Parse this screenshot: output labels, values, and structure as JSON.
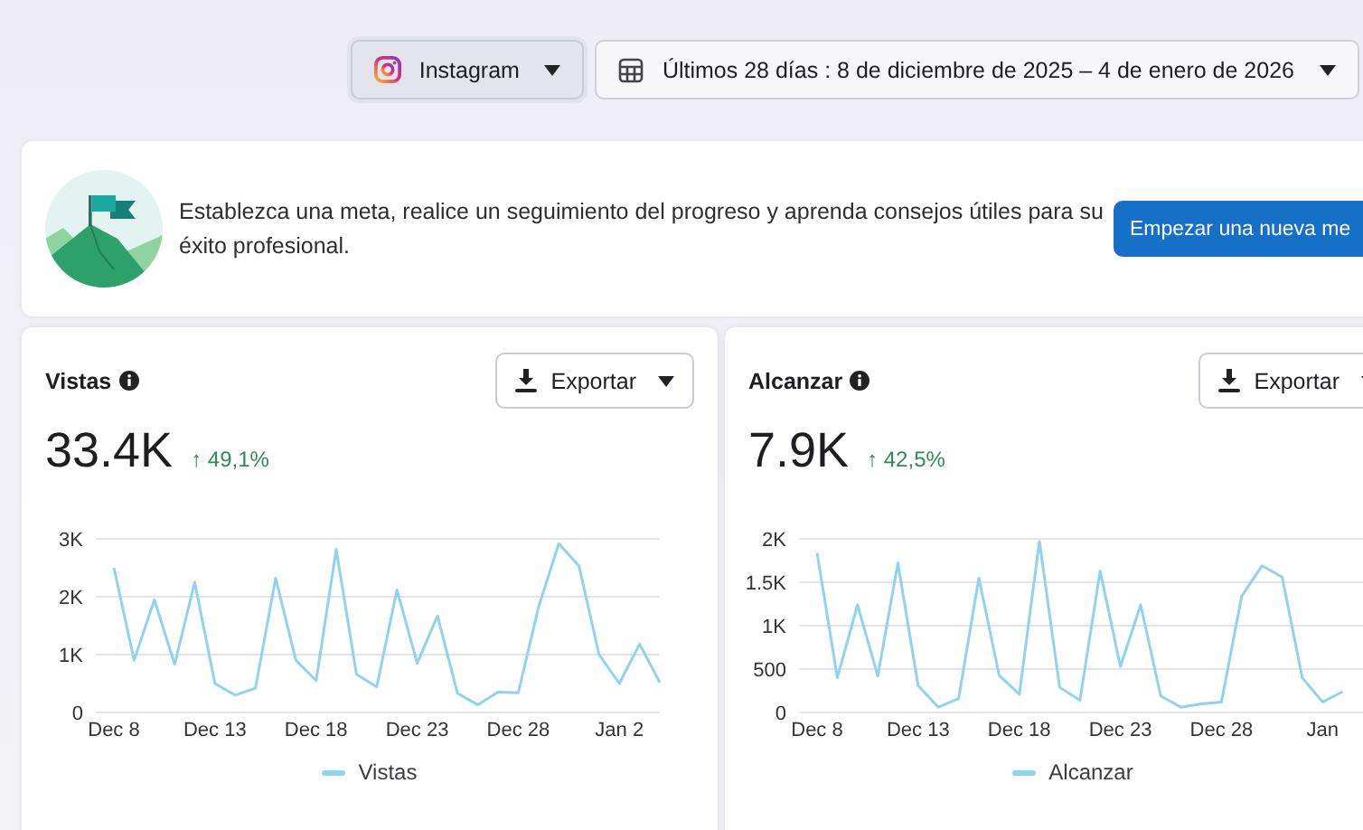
{
  "filters": {
    "platform": {
      "label": "Instagram",
      "selected": true
    },
    "date_range": {
      "label": "Últimos 28 días : 8 de diciembre de 2025 – 4 de enero de 2026"
    }
  },
  "banner": {
    "text": "Establezca una meta, realice un seguimiento del progreso y aprenda consejos útiles para su éxito profesional.",
    "button": "Empezar una nueva me"
  },
  "cards": [
    {
      "title": "Vistas",
      "export": "Exportar",
      "value": "33.4K",
      "change": "↑ 49,1%",
      "chart_data": {
        "type": "line",
        "grid": true,
        "categories": [
          "Dec 8",
          null,
          null,
          null,
          null,
          "Dec 13",
          null,
          null,
          null,
          null,
          "Dec 18",
          null,
          null,
          null,
          null,
          "Dec 23",
          null,
          null,
          null,
          null,
          "Dec 28",
          null,
          null,
          null,
          null,
          "Jan 2",
          null,
          null
        ],
        "series": [
          {
            "name": "Vistas",
            "color": "#8fd3f0",
            "values": [
              2500,
              900,
              1950,
              830,
              2250,
              500,
              300,
              420,
              2320,
              900,
              550,
              2820,
              660,
              440,
              2120,
              850,
              1670,
              330,
              130,
              350,
              340,
              1820,
              2920,
              2530,
              1000,
              500,
              1180,
              520
            ]
          }
        ],
        "ylim": [
          0,
          3000
        ],
        "yticks": [
          {
            "value": 0,
            "label": "0"
          },
          {
            "value": 1000,
            "label": "1K"
          },
          {
            "value": 2000,
            "label": "2K"
          },
          {
            "value": 3000,
            "label": "3K"
          }
        ]
      }
    },
    {
      "title": "Alcanzar",
      "export": "Exportar",
      "value": "7.9K",
      "change": "↑ 42,5%",
      "chart_data": {
        "type": "line",
        "grid": true,
        "categories": [
          "Dec 8",
          null,
          null,
          null,
          null,
          "Dec 13",
          null,
          null,
          null,
          null,
          "Dec 18",
          null,
          null,
          null,
          null,
          "Dec 23",
          null,
          null,
          null,
          null,
          "Dec 28",
          null,
          null,
          null,
          null,
          "Jan",
          null
        ],
        "series": [
          {
            "name": "Alcanzar",
            "color": "#8fd3f0",
            "values": [
              1840,
              400,
              1240,
              420,
              1720,
              310,
              60,
              160,
              1550,
              430,
              210,
              1970,
              290,
              140,
              1630,
              530,
              1240,
              190,
              60,
              100,
              120,
              1340,
              1690,
              1560,
              400,
              120,
              240
            ]
          }
        ],
        "ylim": [
          0,
          2000
        ],
        "yticks": [
          {
            "value": 0,
            "label": "0"
          },
          {
            "value": 500,
            "label": "500"
          },
          {
            "value": 1000,
            "label": "1K"
          },
          {
            "value": 1500,
            "label": "1.5K"
          },
          {
            "value": 2000,
            "label": "2K"
          }
        ]
      }
    }
  ]
}
